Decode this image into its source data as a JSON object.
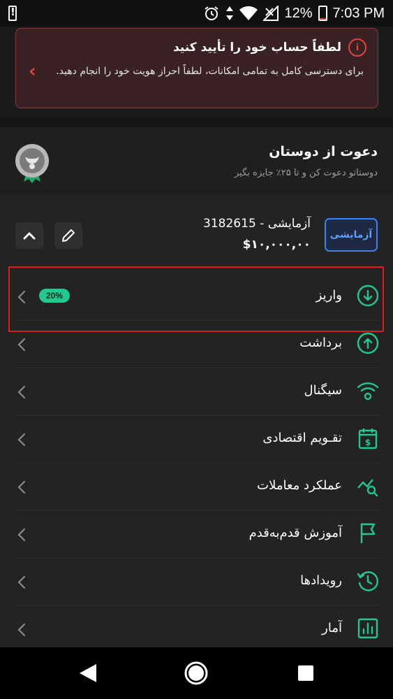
{
  "status_bar": {
    "battery_percent_text": "12%",
    "time": "7:03 PM",
    "battery_level": 0.12
  },
  "alert": {
    "title": "لطفاً حساب خود را تأیید کنید",
    "body": "برای دسترسی کامل به تمامی امکانات، لطفاً احراز هویت خود را انجام دهید."
  },
  "invite": {
    "title": "دعوت از دوستان",
    "subtitle": "دوستاتو دعوت کن و تا ۲۵٪ جایزه بگیر"
  },
  "account": {
    "badge": "آزمایشی",
    "name": "آزمایشی - 3182615",
    "balance": "$۱۰,۰۰۰,۰۰"
  },
  "menu": {
    "items": [
      {
        "label": "واریز",
        "icon": "deposit-icon",
        "pill": "20%"
      },
      {
        "label": "برداشت",
        "icon": "withdraw-icon"
      },
      {
        "label": "سیگنال",
        "icon": "signal-icon"
      },
      {
        "label": "تقـویم اقتصادی",
        "icon": "calendar-icon"
      },
      {
        "label": "عملکرد معاملات",
        "icon": "performance-icon"
      },
      {
        "label": "آموزش قدم‌به‌قدم",
        "icon": "flag-icon"
      },
      {
        "label": "رویدادها",
        "icon": "history-icon"
      },
      {
        "label": "آمار",
        "icon": "stats-icon"
      }
    ]
  },
  "colors": {
    "accent_green": "#22c98e",
    "alert_red": "#e0453e",
    "demo_blue": "#3b82f6",
    "highlight_red": "#e01b1b"
  }
}
